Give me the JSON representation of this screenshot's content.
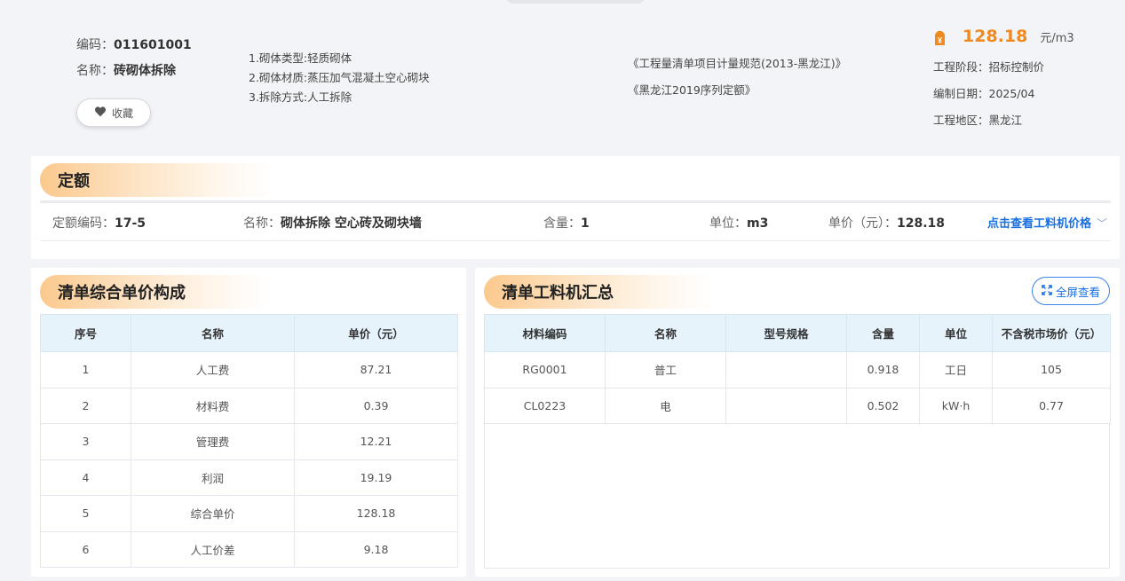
{
  "item": {
    "code_label": "编码：",
    "code_value": "011601001",
    "name_label": "名称：",
    "name_value": "砖砌体拆除",
    "favorite_label": "收藏",
    "description": [
      "1.砌体类型:轻质砌体",
      "2.砌体材质:蒸压加气混凝土空心砌块",
      "3.拆除方式:人工拆除"
    ],
    "specs": [
      "《工程量清单项目计量规范(2013-黑龙江)》",
      "《黑龙江2019序列定额》"
    ],
    "price": "128.18",
    "price_unit": "元/m3",
    "meta": [
      "工程阶段：招标控制价",
      "编制日期：2025/04",
      "工程地区：黑龙江"
    ]
  },
  "quota": {
    "title": "定额",
    "code_label": "定额编码：",
    "code_value": "17-5",
    "name_label": "名称：",
    "name_value": "砌体拆除 空心砖及砌块墙",
    "qty_label": "含量：",
    "qty_value": "1",
    "unit_label": "单位：",
    "unit_value": "m3",
    "price_label": "单价（元）：",
    "price_value": "128.18",
    "link_label": "点击查看工料机价格"
  },
  "composition": {
    "title": "清单综合单价构成",
    "headers": [
      "序号",
      "名称",
      "单价（元）"
    ],
    "rows": [
      [
        "1",
        "人工费",
        "87.21"
      ],
      [
        "2",
        "材料费",
        "0.39"
      ],
      [
        "3",
        "管理费",
        "12.21"
      ],
      [
        "4",
        "利润",
        "19.19"
      ],
      [
        "5",
        "综合单价",
        "128.18"
      ],
      [
        "6",
        "人工价差",
        "9.18"
      ]
    ]
  },
  "materials": {
    "title": "清单工料机汇总",
    "fullscreen_label": "全屏查看",
    "headers": [
      "材料编码",
      "名称",
      "型号规格",
      "含量",
      "单位",
      "不含税市场价（元）"
    ],
    "rows": [
      [
        "RG0001",
        "普工",
        "",
        "0.918",
        "工日",
        "105"
      ],
      [
        "CL0223",
        "电",
        "",
        "0.502",
        "kW·h",
        "0.77"
      ]
    ]
  },
  "colors": {
    "accent_orange": "#f08a1e",
    "link_blue": "#1a6fe0",
    "table_header_bg": "#e6f3fb"
  }
}
